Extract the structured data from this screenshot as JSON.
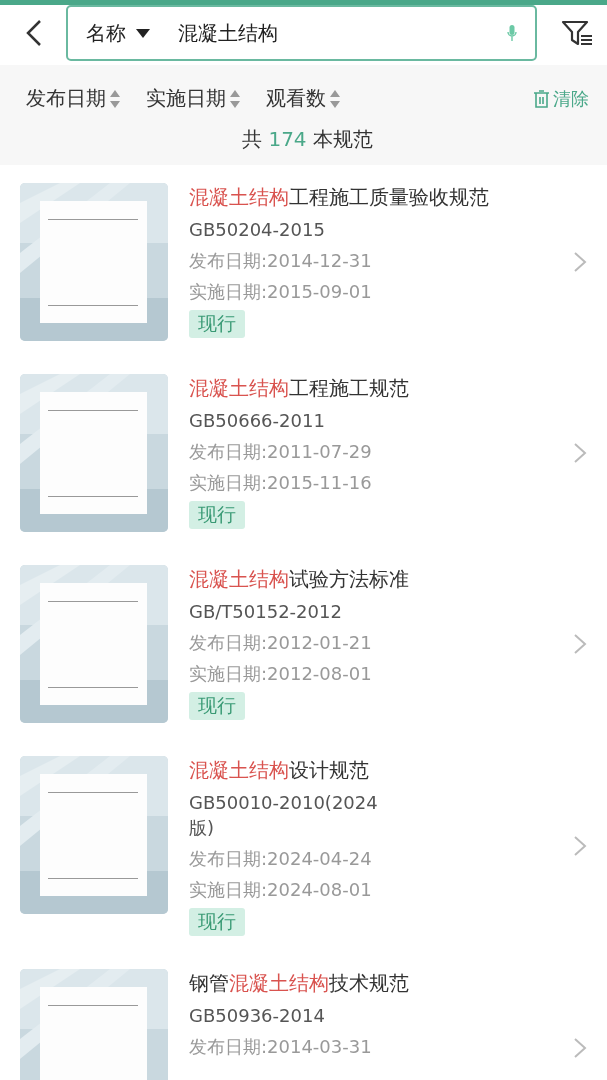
{
  "search": {
    "field_selector": "名称",
    "value": "混凝土结构"
  },
  "sort_options": [
    {
      "label": "发布日期"
    },
    {
      "label": "实施日期"
    },
    {
      "label": "观看数"
    }
  ],
  "clear_label": "清除",
  "summary": {
    "prefix": "共",
    "count": "174",
    "suffix": "本规范"
  },
  "standards": [
    {
      "title": [
        {
          "text": "混凝土结构",
          "highlight": true
        },
        {
          "text": "工程施工质量验收规范",
          "highlight": false
        }
      ],
      "code": "GB50204-2015",
      "publish_date": "发布日期:2014-12-31",
      "effective_date": "实施日期:2015-09-01",
      "status": "现行",
      "cover": {
        "kind": "picture"
      }
    },
    {
      "title": [
        {
          "text": "混凝土结构",
          "highlight": true
        },
        {
          "text": "工程施工规范",
          "highlight": false
        }
      ],
      "code": "GB50666-2011",
      "publish_date": "发布日期:2011-07-29",
      "effective_date": "实施日期:2015-11-16",
      "status": "现行",
      "cover": {
        "kind": "picture"
      }
    },
    {
      "title": [
        {
          "text": "混凝土结构",
          "highlight": true
        },
        {
          "text": "试验方法标准",
          "highlight": false
        }
      ],
      "code": "GB/T50152-2012",
      "publish_date": "发布日期:2012-01-21",
      "effective_date": "实施日期:2012-08-01",
      "status": "现行",
      "cover": {
        "kind": "picture"
      }
    },
    {
      "title": [
        {
          "text": "混凝土结构",
          "highlight": true
        },
        {
          "text": "设计规范",
          "highlight": false
        }
      ],
      "code": "GB50010-2010(2024版)",
      "publish_date": "发布日期:2024-04-24",
      "effective_date": "实施日期:2024-08-01",
      "status": "现行",
      "cover": {
        "kind": "picture"
      }
    },
    {
      "title": [
        {
          "text": "钢管",
          "highlight": false
        },
        {
          "text": "混凝土结构",
          "highlight": true
        },
        {
          "text": "技术规范",
          "highlight": false
        }
      ],
      "code": "GB50936-2014",
      "publish_date": "发布日期:2014-03-31",
      "cover": {
        "kind": "picture"
      }
    }
  ]
}
